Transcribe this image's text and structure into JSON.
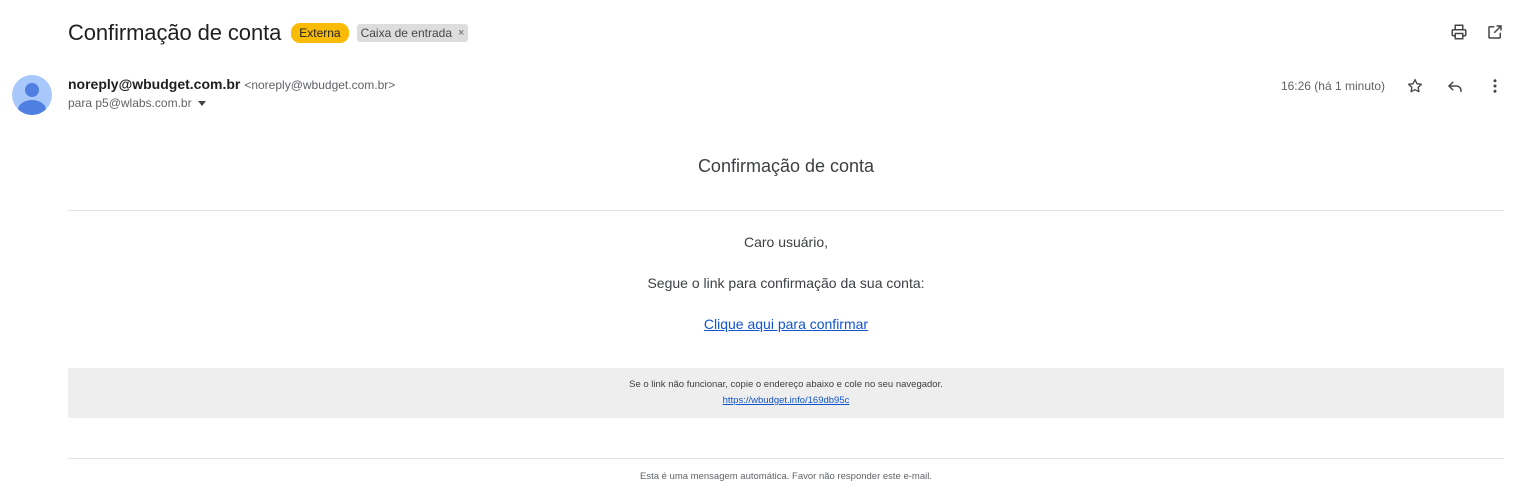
{
  "subject": {
    "title": "Confirmação de conta",
    "labels": {
      "external": "Externa",
      "inbox": "Caixa de entrada",
      "remove": "×"
    }
  },
  "top_actions": {
    "icons": [
      "print-icon",
      "open-in-new-window-icon"
    ]
  },
  "sender": {
    "name": "noreply@wbudget.com.br",
    "email": "<noreply@wbudget.com.br>",
    "to": "para p5@wlabs.com.br",
    "timestamp": "16:26 (há 1 minuto)",
    "icons": [
      "avatar-icon",
      "star-icon",
      "reply-icon",
      "more-vert-icon"
    ]
  },
  "email": {
    "heading": "Confirmação de conta",
    "greeting": "Caro usuário,",
    "instruction": "Segue o link para confirmação da sua conta:",
    "confirm_link": "Clique aqui para confirmar",
    "fallback_text": "Se o link não funcionar, copie o endereço abaixo e cole no seu navegador.",
    "fallback_url": "https://wbudget.info/169db95c",
    "footer": "Esta é uma mensagem automática. Favor não responder este e-mail."
  },
  "colors": {
    "external_badge": "#f9bb05",
    "inbox_badge": "#dddddd",
    "link": "#1155cc",
    "avatar_bg": "#a8c7fa",
    "avatar_fg": "#4f7fe0",
    "fallback_bg": "#eeeeee"
  }
}
